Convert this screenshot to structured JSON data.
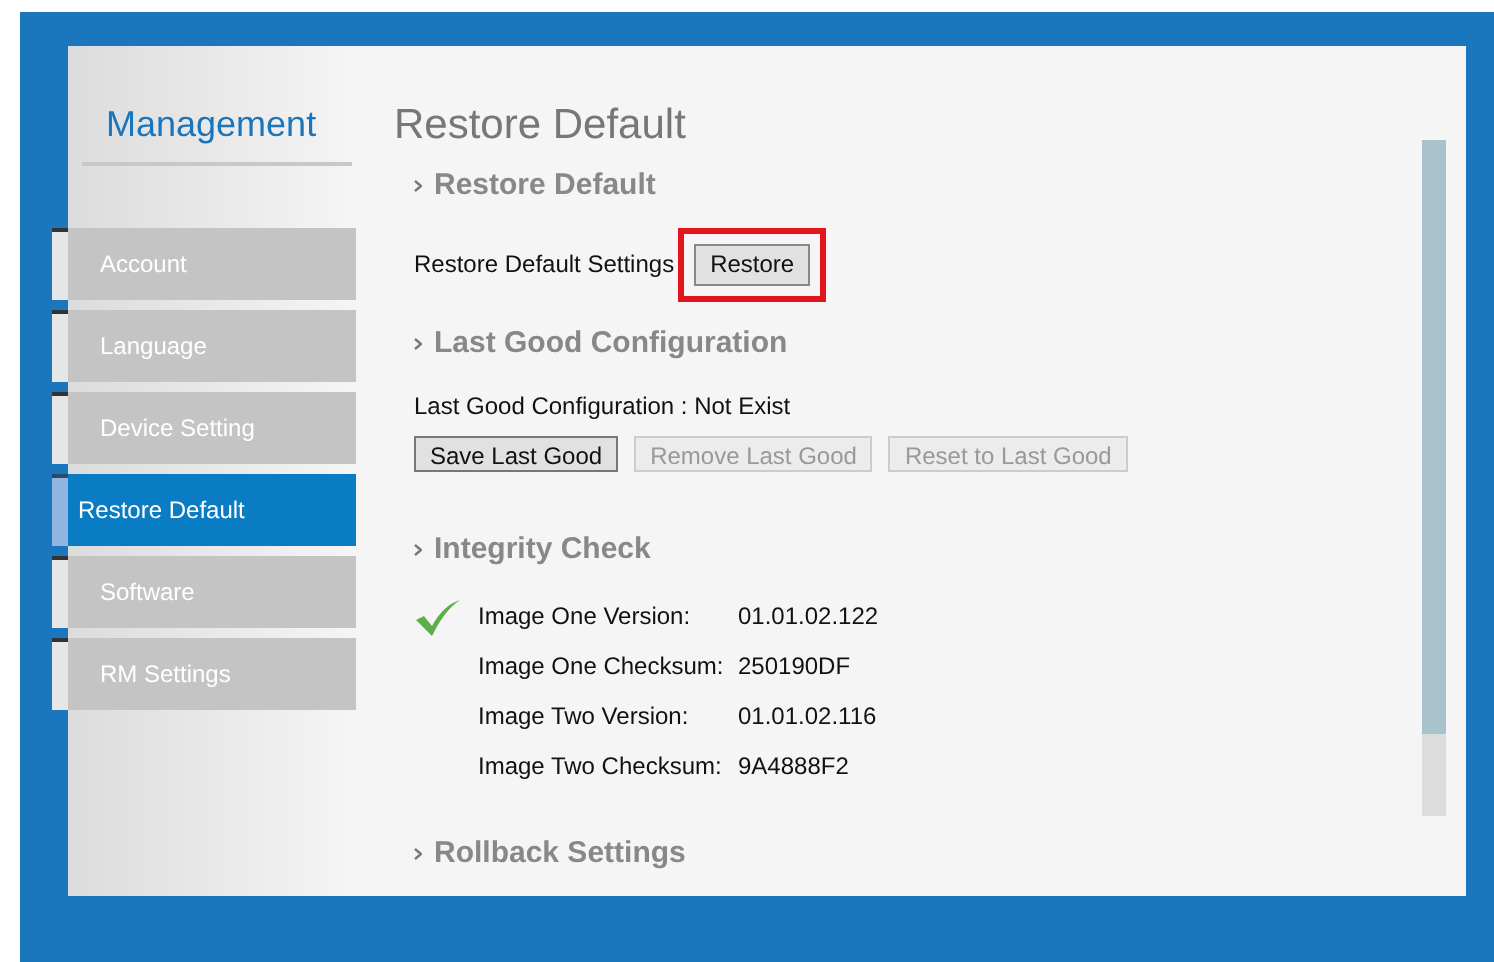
{
  "sidebar": {
    "title": "Management",
    "items": [
      {
        "label": "Account",
        "selected": false
      },
      {
        "label": "Language",
        "selected": false
      },
      {
        "label": "Device Setting",
        "selected": false
      },
      {
        "label": "Restore Default",
        "selected": true
      },
      {
        "label": "Software",
        "selected": false
      },
      {
        "label": "RM Settings",
        "selected": false
      }
    ]
  },
  "page_title": "Restore Default",
  "restore_default": {
    "heading": "Restore Default",
    "label": "Restore Default Settings",
    "button": {
      "label": "Restore",
      "highlighted": true
    }
  },
  "last_good": {
    "heading": "Last Good Configuration",
    "status": "Last Good Configuration : Not Exist",
    "buttons": [
      {
        "label": "Save Last Good",
        "disabled": false
      },
      {
        "label": "Remove Last Good",
        "disabled": true
      },
      {
        "label": "Reset to Last Good",
        "disabled": true
      }
    ]
  },
  "integrity": {
    "heading": "Integrity Check",
    "passed": true,
    "rows": [
      {
        "label": "Image One Version:",
        "value": "01.01.02.122"
      },
      {
        "label": "Image One Checksum:",
        "value": "250190DF"
      },
      {
        "label": "Image Two Version:",
        "value": "01.01.02.116"
      },
      {
        "label": "Image Two Checksum:",
        "value": "9A4888F2"
      }
    ]
  },
  "rollback": {
    "heading": "Rollback Settings"
  }
}
